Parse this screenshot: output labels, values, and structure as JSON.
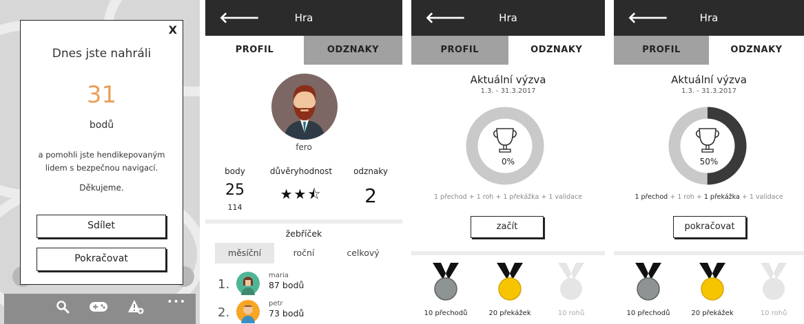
{
  "dialog": {
    "close": "X",
    "title": "Dnes jste nahráli",
    "points": "31",
    "points_unit": "bodů",
    "message": "a pomohli jste hendikepovaným lidem s bezpečnou navigací.",
    "thanks": "Děkujeme.",
    "share": "Sdílet",
    "continue": "Pokračovat",
    "more": "•••"
  },
  "header": {
    "title": "Hra",
    "back": "🡐"
  },
  "tabs": {
    "profile": "PROFIL",
    "badges": "ODZNAKY"
  },
  "profile": {
    "name": "fero",
    "stats": {
      "points_label": "body",
      "trust_label": "důvěryhodnost",
      "badges_label": "odznaky",
      "points_value": "25",
      "points_sub": "114",
      "trust_stars": "★★⯪",
      "badges_value": "2"
    },
    "leaderboard": {
      "title": "žebříček",
      "periods": [
        "měsíční",
        "roční",
        "celkový"
      ],
      "rows": [
        {
          "rank": "1.",
          "name": "maria",
          "points": "87 bodů"
        },
        {
          "rank": "2.",
          "name": "petr",
          "points": "73 bodů"
        }
      ]
    }
  },
  "challenge_a": {
    "title": "Aktuální výzva",
    "dates": "1.3. - 31.3.2017",
    "percent": "0%",
    "progress": 0,
    "req_parts": [
      "1 přechod",
      "+",
      "1 roh",
      "+",
      "1 překážka",
      "+",
      "1 validace"
    ],
    "button": "začít"
  },
  "challenge_b": {
    "title": "Aktuální výzva",
    "dates": "1.3. - 31.3.2017",
    "percent": "50%",
    "progress": 0.5,
    "req_parts": [
      "1 přechod",
      "+",
      "1 roh",
      "+",
      "1 překážka",
      "+",
      "1 validace"
    ],
    "button": "pokračovat"
  },
  "medals": [
    {
      "label": "10 přechodů",
      "color": "#8e9494"
    },
    {
      "label": "20 překážek",
      "color": "#f7c500"
    },
    {
      "label": "10 rohů",
      "color": "#e5e5e5"
    }
  ],
  "colors": {
    "header": "#2b2b2b",
    "accent": "#e99f5b",
    "inactive_tab": "#a1a1a1"
  }
}
